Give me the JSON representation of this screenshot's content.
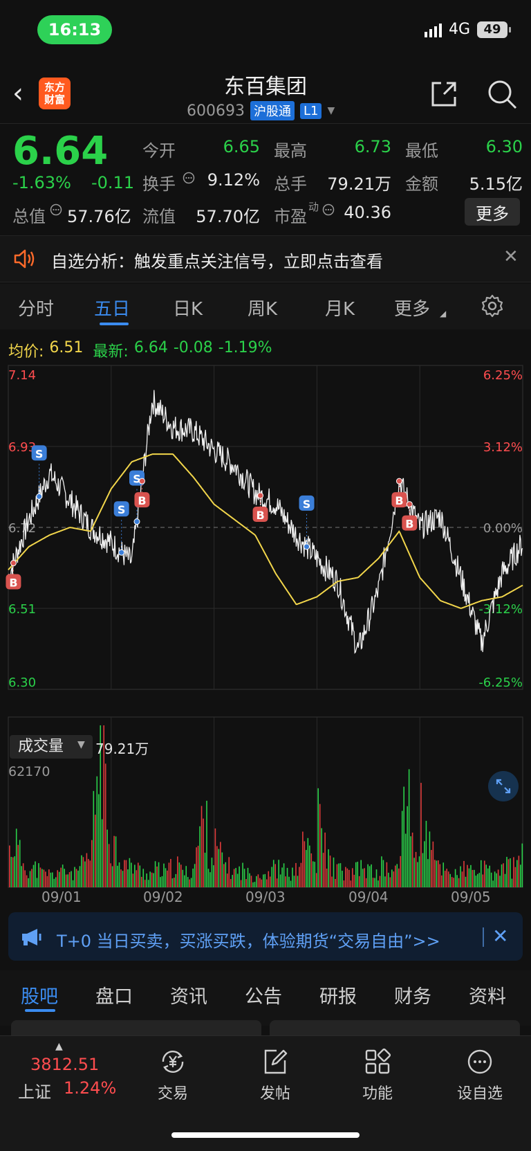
{
  "status": {
    "time": "16:13",
    "network": "4G",
    "battery": "49"
  },
  "header": {
    "logo_line1": "东方",
    "logo_line2": "财富",
    "title": "东百集团",
    "code": "600693",
    "market_tag": "沪股通",
    "level_tag": "L1"
  },
  "quote": {
    "price": "6.64",
    "change_pct": "-1.63%",
    "change": "-0.11",
    "total_mv_label": "总值",
    "total_mv": "57.76亿",
    "grid": [
      {
        "label": "今开",
        "value": "6.65",
        "color": "green"
      },
      {
        "label": "最高",
        "value": "6.73",
        "color": "green"
      },
      {
        "label": "最低",
        "value": "6.30",
        "color": "green"
      },
      {
        "label": "换手",
        "value": "9.12%",
        "color": "white"
      },
      {
        "label": "总手",
        "value": "79.21万",
        "color": "white"
      },
      {
        "label": "金额",
        "value": "5.15亿",
        "color": "white"
      },
      {
        "label": "流值",
        "value": "57.70亿",
        "color": "white"
      },
      {
        "label": "市盈",
        "sup": "动",
        "value": "40.36",
        "color": "white"
      }
    ],
    "more_label": "更多"
  },
  "notice": {
    "text": "自选分析：触发重点关注信号，立即点击查看"
  },
  "chart_tabs": [
    "分时",
    "五日",
    "日K",
    "周K",
    "月K",
    "更多"
  ],
  "info_line": {
    "avg_label": "均价:",
    "avg_value": "6.51",
    "latest_label": "最新:",
    "latest_value": "6.64",
    "latest_change": "-0.08",
    "latest_pct": "-1.19%"
  },
  "volume": {
    "label": "成交量",
    "total": "79.21万",
    "max": "62170"
  },
  "chart_data": {
    "type": "line",
    "x": [
      "09/01",
      "09/02",
      "09/03",
      "09/04",
      "09/05"
    ],
    "price_axis": [
      "7.14",
      "6.93",
      "6.72",
      "6.51",
      "6.30"
    ],
    "pct_axis": [
      "6.25%",
      "3.12%",
      "0.00%",
      "-3.12%",
      "-6.25%"
    ],
    "ylim": [
      6.3,
      7.14
    ],
    "baseline": 6.72,
    "series": [
      {
        "name": "均价",
        "values": [
          6.61,
          6.67,
          6.7,
          6.72,
          6.71,
          6.82,
          6.89,
          6.91,
          6.91,
          6.85,
          6.78,
          6.74,
          6.7,
          6.6,
          6.52,
          6.54,
          6.58,
          6.59,
          6.64,
          6.71,
          6.59,
          6.53,
          6.51,
          6.53,
          6.54,
          6.57
        ]
      },
      {
        "values": [
          6.59,
          6.74,
          6.86,
          6.79,
          6.72,
          6.68,
          6.63,
          7.05,
          6.98,
          6.97,
          6.92,
          6.88,
          6.81,
          6.78,
          6.7,
          6.64,
          6.58,
          6.4,
          6.56,
          6.84,
          6.72,
          6.75,
          6.59,
          6.42,
          6.6,
          6.68
        ]
      }
    ],
    "markers": [
      {
        "text": "S",
        "type": "sell"
      },
      {
        "text": "S",
        "type": "sell"
      },
      {
        "text": "S",
        "type": "sell"
      },
      {
        "text": "S",
        "type": "sell"
      },
      {
        "text": "B",
        "type": "buy"
      },
      {
        "text": "B",
        "type": "buy"
      },
      {
        "text": "B",
        "type": "buy"
      },
      {
        "text": "B",
        "type": "buy"
      },
      {
        "text": "B",
        "type": "buy"
      }
    ],
    "volume_days": [
      [
        22,
        30,
        18,
        14,
        10,
        12,
        8,
        9,
        7,
        11,
        9,
        10,
        8,
        12,
        14,
        18,
        60,
        95,
        40,
        25
      ],
      [
        30,
        22,
        16,
        12,
        14,
        10,
        9,
        8,
        11,
        10,
        9,
        12,
        13,
        10,
        8,
        12,
        30,
        45,
        20,
        18
      ],
      [
        25,
        18,
        14,
        10,
        9,
        11,
        8,
        7,
        9,
        8,
        10,
        12,
        11,
        9,
        8,
        10,
        22,
        28,
        16,
        12
      ],
      [
        40,
        28,
        16,
        12,
        10,
        9,
        8,
        10,
        12,
        11,
        9,
        8,
        14,
        10,
        9,
        12,
        70,
        40,
        22,
        16
      ],
      [
        45,
        30,
        20,
        14,
        12,
        10,
        9,
        8,
        11,
        10,
        9,
        12,
        10,
        8,
        9,
        11,
        14,
        12,
        16,
        18
      ]
    ]
  },
  "promo": {
    "text": "T+0 当日买卖，买涨买跌，体验期货“交易自由”>>"
  },
  "info_tabs": [
    "股吧",
    "盘口",
    "资讯",
    "公告",
    "研报",
    "财务",
    "资料"
  ],
  "bottom_nav": {
    "index_value": "3812.51",
    "index_name": "上证",
    "index_pct": "1.24%",
    "items": [
      "交易",
      "发帖",
      "功能",
      "设自选"
    ]
  }
}
